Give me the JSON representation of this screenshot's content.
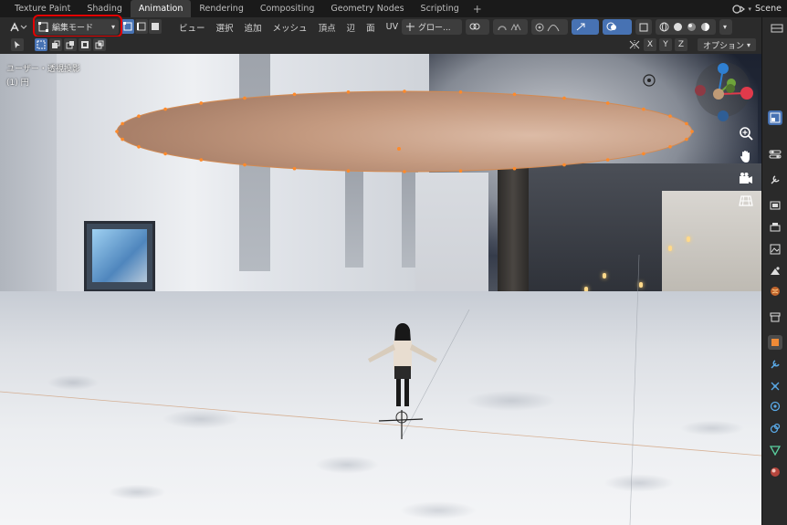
{
  "workspace_tabs": [
    {
      "label": "Texture Paint",
      "active": false
    },
    {
      "label": "Shading",
      "active": false
    },
    {
      "label": "Animation",
      "active": true
    },
    {
      "label": "Rendering",
      "active": false
    },
    {
      "label": "Compositing",
      "active": false
    },
    {
      "label": "Geometry Nodes",
      "active": false
    },
    {
      "label": "Scripting",
      "active": false
    }
  ],
  "add_workspace_label": "+",
  "scene": {
    "label": "Scene"
  },
  "header": {
    "mode_label": "編集モード",
    "menus": [
      "ビュー",
      "選択",
      "追加",
      "メッシュ",
      "頂点",
      "辺",
      "面",
      "UV"
    ],
    "transform_orientation": "グロー..."
  },
  "header2": {
    "axis_x": "X",
    "axis_y": "Y",
    "axis_z": "Z",
    "options_label": "オプション"
  },
  "viewport": {
    "view_name": "ユーザー・透視投影",
    "frame_info": "(1) 円"
  },
  "colors": {
    "mode_highlight": "#e30000",
    "active_blue": "#4772b3",
    "mesh_fill": "#c49a80",
    "vertex": "#ff8a2a"
  },
  "icons": {
    "editor_type": "editor-type-icon",
    "mode": "edit-mode-icon",
    "select_vertex": "vertex-select-icon",
    "select_edge": "edge-select-icon",
    "select_face": "face-select-icon"
  }
}
